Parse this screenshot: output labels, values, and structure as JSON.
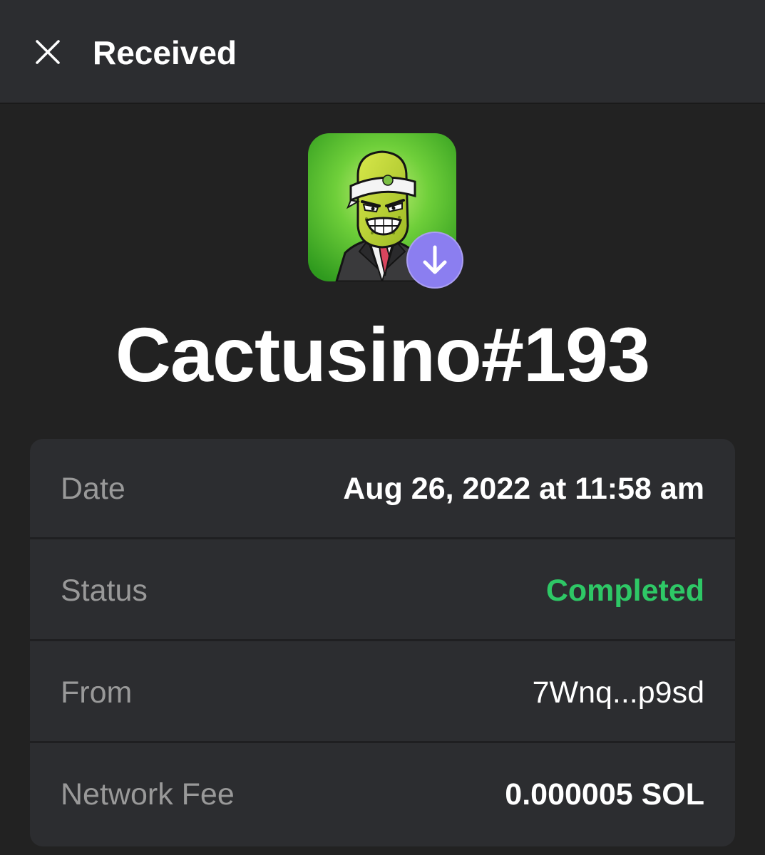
{
  "header": {
    "title": "Received",
    "close_icon": "close-icon"
  },
  "nft": {
    "name": "Cactusino#193",
    "image_icon": "cactus-character-avatar",
    "badge_icon": "arrow-down-icon",
    "colors": {
      "image_bg": "#4caf2a",
      "badge_bg": "#ab9ff2"
    }
  },
  "details": {
    "rows": [
      {
        "label": "Date",
        "value": "Aug 26, 2022 at 11:58 am"
      },
      {
        "label": "Status",
        "value": "Completed"
      },
      {
        "label": "From",
        "value": "7Wnq...p9sd"
      },
      {
        "label": "Network Fee",
        "value": "0.000005 SOL"
      }
    ],
    "status_color": "#2ec866"
  }
}
